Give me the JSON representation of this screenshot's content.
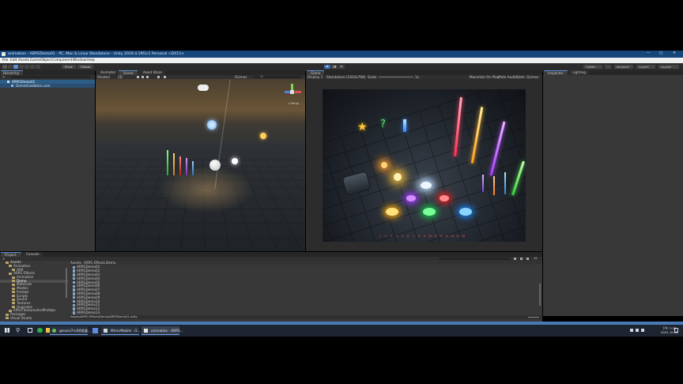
{
  "window": {
    "title": "animation - ARPGDemo01 - PC, Mac & Linux Standalone - Unity 2019.4.19f1c1 Personal <DX11>"
  },
  "menu": [
    "File",
    "Edit",
    "Assets",
    "GameObject",
    "Component",
    "Window",
    "Help"
  ],
  "toolbar": {
    "pivot": "Pivot",
    "global": "Global",
    "collab": "Collab",
    "account": "Account",
    "layers": "Layers",
    "layout": "Layout"
  },
  "hierarchy": {
    "tab": "Hierarchy",
    "add": "+",
    "search_placeholder": "All",
    "items": [
      "ARPGDemo01",
      "DemoGradation.cam"
    ]
  },
  "scene_tabs": [
    "Animator",
    "Scene",
    "Asset Store"
  ],
  "scene_bar": {
    "shading": "Shaded",
    "mode": "2D",
    "gizmos": "Gizmos",
    "search": "All",
    "persp": "< Persp"
  },
  "game": {
    "tab": "Game",
    "display": "Display 1",
    "resolution": "Standalone (1024x768)",
    "scale_label": "Scale",
    "scale_value": "1x",
    "maximize": "Maximize On Play",
    "mute": "Mute Audio",
    "stats": "Stats",
    "gizmos": "Gizmos",
    "skill_bar": [
      "1",
      "2",
      "3",
      "4",
      "5",
      "6",
      "7",
      "8",
      "9",
      "10",
      "11",
      "12",
      "13",
      "14",
      "15",
      "16"
    ]
  },
  "inspector": {
    "tab": "Inspector",
    "lighting": "Lighting"
  },
  "project": {
    "tabs": [
      "Project",
      "Console"
    ],
    "add": "+",
    "tree": [
      {
        "label": "Assets",
        "indent": 0
      },
      {
        "label": "Animation",
        "indent": 1
      },
      {
        "label": "ARR",
        "indent": 2
      },
      {
        "label": "ARPG Effects",
        "indent": 1
      },
      {
        "label": "Animation",
        "indent": 2
      },
      {
        "label": "Demo",
        "indent": 2
      },
      {
        "label": "Materials",
        "indent": 2
      },
      {
        "label": "Models",
        "indent": 2
      },
      {
        "label": "Prefabs",
        "indent": 2
      },
      {
        "label": "Scripts",
        "indent": 2
      },
      {
        "label": "Sound",
        "indent": 2
      },
      {
        "label": "Textures",
        "indent": 2
      },
      {
        "label": "Upgrades",
        "indent": 2
      },
      {
        "label": "EffectTexturesAndPrefabs",
        "indent": 1
      },
      {
        "label": "Packages",
        "indent": 0
      },
      {
        "label": "Visual Studio",
        "indent": 0
      }
    ],
    "breadcrumb": [
      "Assets",
      "ARPG Effects",
      "Demo"
    ],
    "files": [
      "ARPGDemo01",
      "ARPGDemo02",
      "ARPGDemo03",
      "ARPGDemo04",
      "ARPGDemo05",
      "ARPGDemo06",
      "ARPGDemo07",
      "ARPGDemo08",
      "ARPGDemo09",
      "ARPGDemo10",
      "ARPGDemo11",
      "ARPGDemo12",
      "ARPGDemo13"
    ],
    "status_path": "Assets/ARPG Effects/Demo/ARPGDemo01.unity",
    "count": "15"
  },
  "taskbar": {
    "apps": [
      "geovisi7ruf浏览器...",
      "MirrorMobile - O...",
      "animation - ARPG..."
    ],
    "time": "下午 7:38",
    "date": "2021 10:08"
  },
  "colors": {
    "unity_blue": "#16467a",
    "selection": "#2c5d87",
    "panel": "#383838",
    "play_active": "#5a8fd8"
  }
}
